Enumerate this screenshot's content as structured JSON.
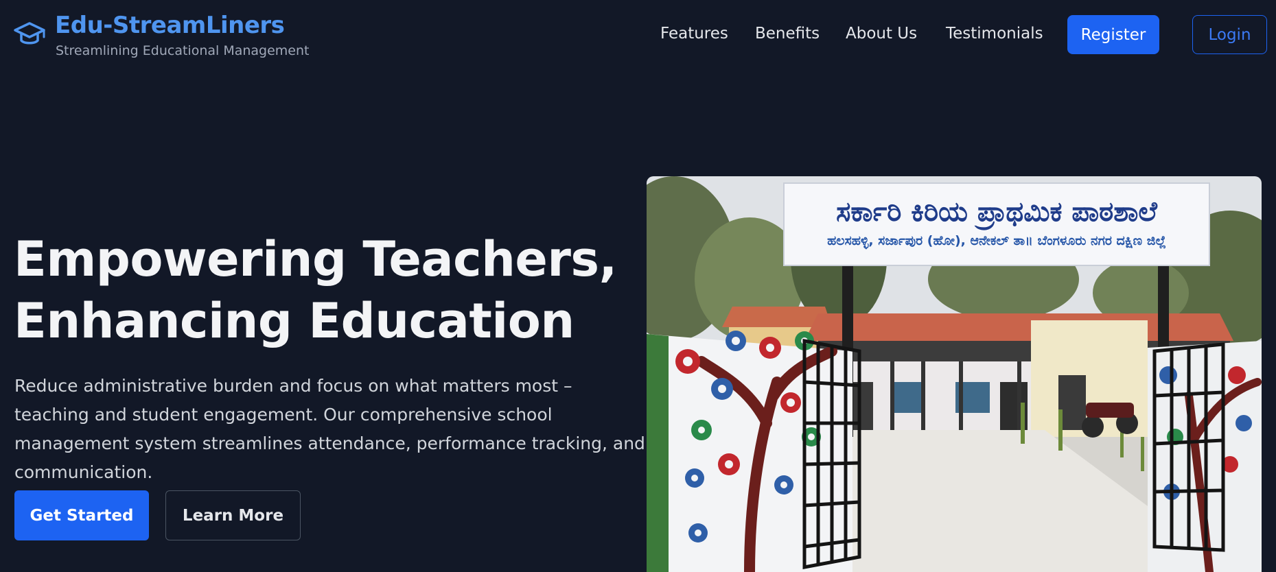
{
  "header": {
    "logo_icon": "graduation-cap-icon",
    "brand_name": "Edu-StreamLiners",
    "tagline": "Streamlining Educational Management",
    "nav": [
      {
        "label": "Features"
      },
      {
        "label": "Benefits"
      },
      {
        "label": "About Us"
      },
      {
        "label": "Testimonials"
      }
    ],
    "register_label": "Register",
    "login_label": "Login"
  },
  "hero": {
    "title_line1": "Empowering Teachers,",
    "title_line2": "Enhancing Education",
    "description": "Reduce administrative burden and focus on what matters most – teaching and student engagement. Our comprehensive school management system streamlines attendance, performance tracking, and communication.",
    "primary_cta": "Get Started",
    "secondary_cta": "Learn More",
    "image": {
      "sign_title": "ಸರ್ಕಾರಿ ಕಿರಿಯ ಪ್ರಾಥಮಿಕ ಪಾಠಶಾಲೆ",
      "sign_subtitle": "ಹಲಸಹಳ್ಳಿ, ಸರ್ಜಾಪುರ (ಹೋ), ಆನೇಕಲ್ ತಾ॥ ಬೆಂಗಳೂರು ನಗರ ದಕ್ಷಿಣ ಜಿಲ್ಲೆ"
    }
  },
  "colors": {
    "background": "#121827",
    "accent": "#1d63f2",
    "brand": "#4f95ef"
  }
}
